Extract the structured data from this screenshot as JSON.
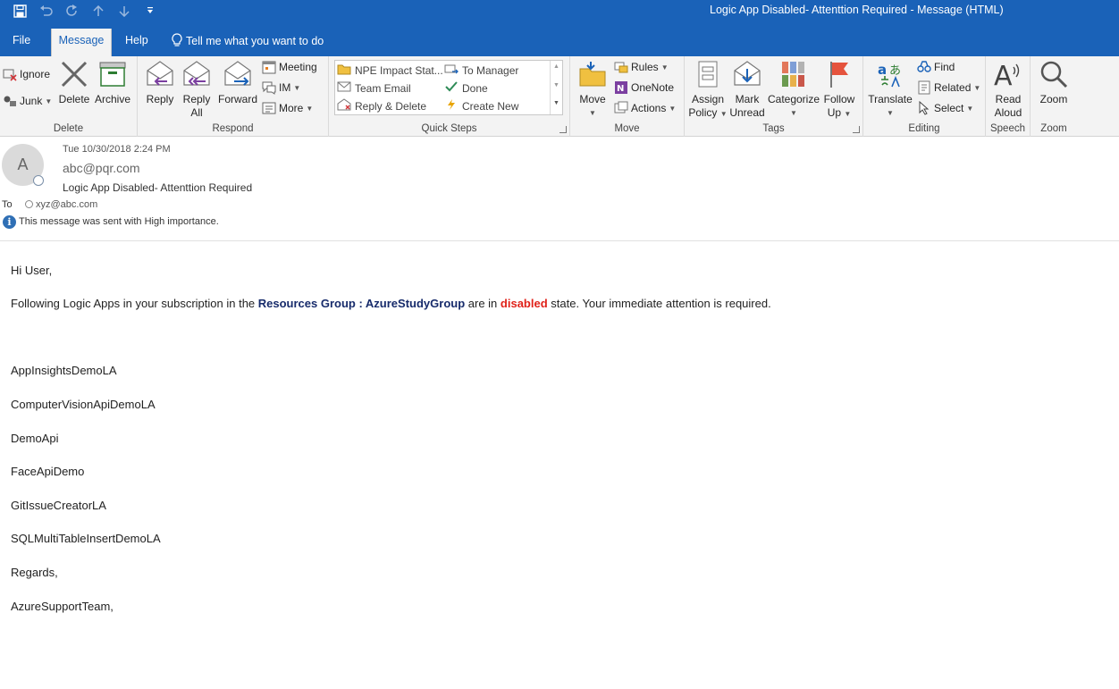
{
  "window": {
    "title": "Logic App Disabled- Attenttion Required  -  Message (HTML)"
  },
  "qat": {
    "icons": [
      "save-icon",
      "undo-icon",
      "redo-icon",
      "up-icon",
      "down-icon",
      "customize-icon"
    ]
  },
  "tabs": {
    "file": "File",
    "message": "Message",
    "help": "Help",
    "tell_me": "Tell me what you want to do"
  },
  "ribbon": {
    "delete_group": {
      "label": "Delete",
      "ignore": "Ignore",
      "junk": "Junk",
      "delete": "Delete",
      "archive": "Archive"
    },
    "respond_group": {
      "label": "Respond",
      "reply": "Reply",
      "reply_all_1": "Reply",
      "reply_all_2": "All",
      "forward": "Forward",
      "meeting": "Meeting",
      "im": "IM",
      "more": "More"
    },
    "quick_steps_group": {
      "label": "Quick Steps",
      "items": [
        "NPE Impact Stat...",
        "Team Email",
        "Reply & Delete",
        "To Manager",
        "Done",
        "Create New"
      ]
    },
    "move_group": {
      "label": "Move",
      "move": "Move",
      "rules": "Rules",
      "onenote": "OneNote",
      "actions": "Actions"
    },
    "tags_group": {
      "label": "Tags",
      "assign_1": "Assign",
      "assign_2": "Policy",
      "mark_1": "Mark",
      "mark_2": "Unread",
      "categorize": "Categorize",
      "follow_1": "Follow",
      "follow_2": "Up"
    },
    "editing_group": {
      "label": "Editing",
      "translate": "Translate",
      "find": "Find",
      "related": "Related",
      "select": "Select"
    },
    "speech_group": {
      "label": "Speech",
      "read_1": "Read",
      "read_2": "Aloud"
    },
    "zoom_group": {
      "label": "Zoom",
      "zoom": "Zoom"
    }
  },
  "message_header": {
    "avatar_initial": "A",
    "date": "Tue 10/30/2018 2:24 PM",
    "from": "abc@pqr.com",
    "subject": "Logic App Disabled- Attenttion Required",
    "to_label": "To",
    "to": "xyz@abc.com",
    "importance": "This message was sent with High importance."
  },
  "body": {
    "greeting": "Hi User,",
    "intro_1": "Following Logic Apps in your subscription in the ",
    "intro_rg": "Resources Group : AzureStudyGroup",
    "intro_2": " are in ",
    "intro_disabled": "disabled",
    "intro_3": " state. Your immediate attention is required.",
    "apps": [
      "AppInsightsDemoLA",
      "ComputerVisionApiDemoLA",
      "DemoApi",
      "FaceApiDemo",
      "GitIssueCreatorLA",
      "SQLMultiTableInsertDemoLA"
    ],
    "regards": "Regards,",
    "signature": "AzureSupportTeam,"
  },
  "colors": {
    "accent": "#1a62b8",
    "ribbon_bg": "#f3f3f3",
    "highlight_blue": "#172b6b",
    "highlight_red": "#e0221a"
  }
}
